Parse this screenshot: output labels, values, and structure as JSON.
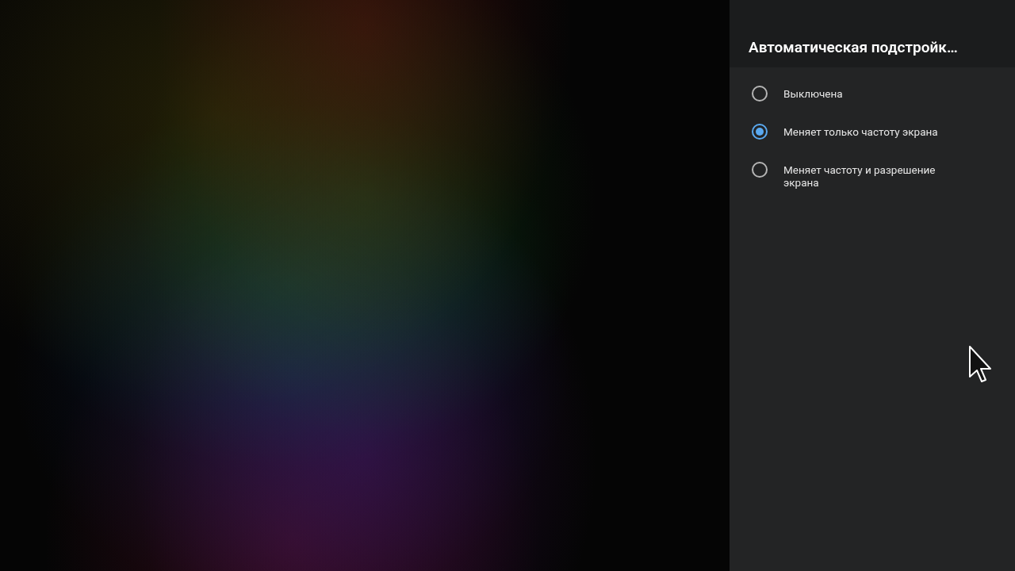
{
  "panel": {
    "title": "Автоматическая подстройк…",
    "options": [
      {
        "label": "Выключена",
        "selected": false
      },
      {
        "label": "Меняет только частоту экрана",
        "selected": true
      },
      {
        "label": "Меняет частоту и разрешение экрана",
        "selected": false
      }
    ]
  }
}
